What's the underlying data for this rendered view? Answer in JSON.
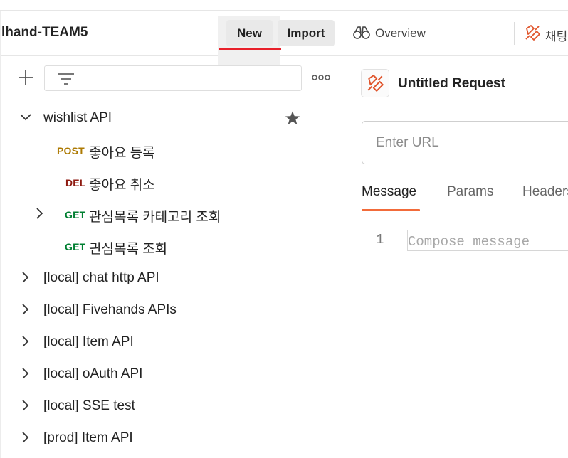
{
  "workspace": {
    "title": "lhand-TEAM5",
    "new_label": "New",
    "import_label": "Import"
  },
  "tree": {
    "rows": [
      {
        "label": "wishlist API"
      },
      {
        "method": "POST",
        "label": "좋아요 등록"
      },
      {
        "method": "DEL",
        "label": "좋아요 취소"
      },
      {
        "method": "GET",
        "label": "관심목록 카테고리 조회"
      },
      {
        "method": "GET",
        "label": "긘심목록 조회"
      },
      {
        "label": "[local] chat http API"
      },
      {
        "label": "[local] Fivehands APIs"
      },
      {
        "label": "[local] Item API"
      },
      {
        "label": "[local] oAuth API"
      },
      {
        "label": "[local] SSE test"
      },
      {
        "label": "[prod] Item API"
      }
    ]
  },
  "tabs": {
    "overview_label": "Overview",
    "chat_label": "채팅"
  },
  "request": {
    "title": "Untitled Request",
    "url_placeholder": "Enter URL",
    "subtabs": [
      "Message",
      "Params",
      "Headers"
    ],
    "line_number": "1",
    "compose_placeholder": "Compose message"
  },
  "colors": {
    "accent": "#f26b3a",
    "highlight_red": "#e8202a",
    "post": "#ad7a03",
    "del": "#8e1a10",
    "get": "#007f31"
  },
  "icons": {
    "plus": "plus-icon",
    "filter": "filter-icon",
    "more": "more-icon",
    "chevron_down": "chevron-down-icon",
    "chevron_right": "chevron-right-icon",
    "star": "star-icon",
    "overview": "binoculars-icon",
    "request": "socket-request-icon"
  }
}
